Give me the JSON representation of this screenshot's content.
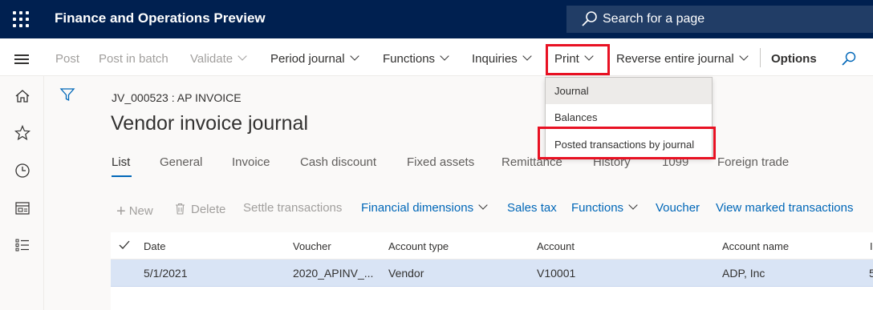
{
  "header": {
    "app_title": "Finance and Operations Preview",
    "search_placeholder": "Search for a page",
    "icons": [
      "waffle-icon",
      "search-icon"
    ]
  },
  "actionbar": {
    "post": "Post",
    "post_in_batch": "Post in batch",
    "validate": "Validate",
    "period_journal": "Period journal",
    "functions": "Functions",
    "inquiries": "Inquiries",
    "print": "Print",
    "reverse_entire_journal": "Reverse entire journal",
    "options": "Options"
  },
  "print_menu": {
    "items": [
      "Journal",
      "Balances",
      "Posted transactions by journal"
    ],
    "selected": "Journal"
  },
  "nav": {
    "icons": [
      "home-icon",
      "star-icon",
      "clock-icon",
      "workspace-icon",
      "list-icon"
    ]
  },
  "page": {
    "breadcrumb": "JV_000523 : AP INVOICE",
    "title": "Vendor invoice journal"
  },
  "tabs": [
    "List",
    "General",
    "Invoice",
    "Cash discount",
    "Fixed assets",
    "Remittance",
    "History",
    "1099",
    "Foreign trade"
  ],
  "grid_actions": {
    "new": "New",
    "delete": "Delete",
    "settle_transactions": "Settle transactions",
    "financial_dimensions": "Financial dimensions",
    "sales_tax": "Sales tax",
    "functions": "Functions",
    "voucher": "Voucher",
    "view_marked_transactions": "View marked transactions"
  },
  "grid": {
    "columns": [
      "Date",
      "Voucher",
      "Account type",
      "Account",
      "Account name"
    ],
    "rows": [
      {
        "date": "5/1/2021",
        "voucher": "2020_APINV_...",
        "account_type": "Vendor",
        "account": "V10001",
        "account_name": "ADP, Inc",
        "extra": "5"
      }
    ]
  },
  "colors": {
    "header_bg": "#002050",
    "accent": "#0067b8",
    "highlight_box": "#e81123",
    "selected_row": "#d9e4f5"
  }
}
